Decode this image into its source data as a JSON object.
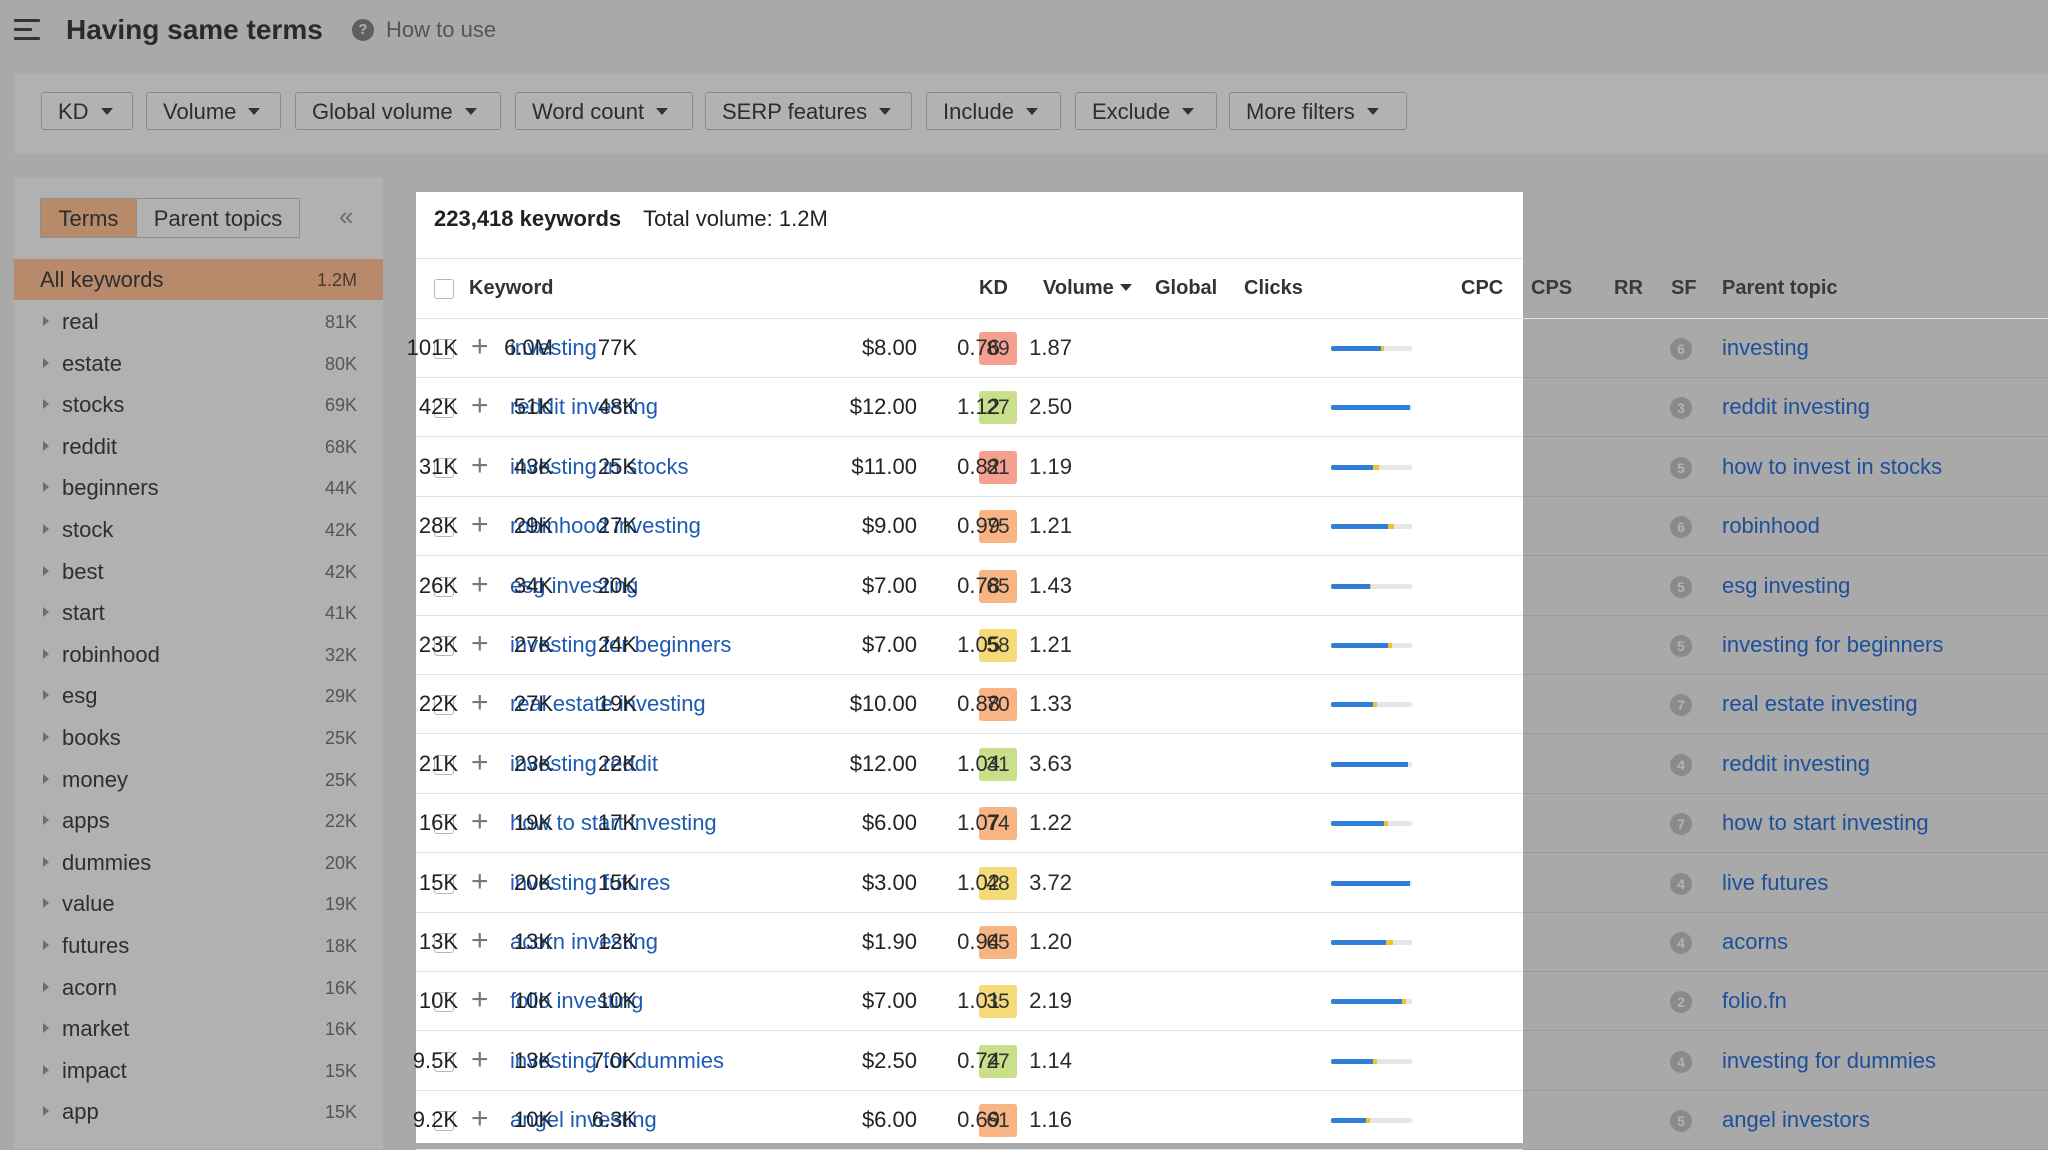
{
  "header": {
    "title": "Having same terms",
    "help_text": "How to use"
  },
  "filters": [
    "KD",
    "Volume",
    "Global volume",
    "Word count",
    "SERP features",
    "Include",
    "Exclude",
    "More filters"
  ],
  "sidebar": {
    "tabs": [
      "Terms",
      "Parent topics"
    ],
    "all_keywords": {
      "label": "All keywords",
      "count": "1.2M"
    },
    "items": [
      {
        "label": "real",
        "count": "81K"
      },
      {
        "label": "estate",
        "count": "80K"
      },
      {
        "label": "stocks",
        "count": "69K"
      },
      {
        "label": "reddit",
        "count": "68K"
      },
      {
        "label": "beginners",
        "count": "44K"
      },
      {
        "label": "stock",
        "count": "42K"
      },
      {
        "label": "best",
        "count": "42K"
      },
      {
        "label": "start",
        "count": "41K"
      },
      {
        "label": "robinhood",
        "count": "32K"
      },
      {
        "label": "esg",
        "count": "29K"
      },
      {
        "label": "books",
        "count": "25K"
      },
      {
        "label": "money",
        "count": "25K"
      },
      {
        "label": "apps",
        "count": "22K"
      },
      {
        "label": "dummies",
        "count": "20K"
      },
      {
        "label": "value",
        "count": "19K"
      },
      {
        "label": "futures",
        "count": "18K"
      },
      {
        "label": "acorn",
        "count": "16K"
      },
      {
        "label": "market",
        "count": "16K"
      },
      {
        "label": "impact",
        "count": "15K"
      },
      {
        "label": "app",
        "count": "15K"
      }
    ]
  },
  "summary": {
    "keywords": "223,418 keywords",
    "total_volume": "Total volume: 1.2M"
  },
  "columns": {
    "keyword": "Keyword",
    "kd": "KD",
    "volume": "Volume",
    "global": "Global",
    "clicks": "Clicks",
    "cpc": "CPC",
    "cps": "CPS",
    "rr": "RR",
    "sf": "SF",
    "parent_topic": "Parent topic"
  },
  "colors": {
    "kd_red": "#f5a08f",
    "kd_orange": "#f8b483",
    "kd_yellow": "#f5da78",
    "kd_lightgreen": "#c9df8a",
    "link": "#1d5ab2",
    "bar_blue": "#2f7ed8",
    "bar_yellow": "#f2c12e"
  },
  "rows": [
    {
      "keyword": "investing",
      "kd": "89",
      "kd_color": "#f5a08f",
      "volume": "101K",
      "global": "6.0M",
      "clicks": "77K",
      "organic_share": 0.62,
      "paid_share": 0.03,
      "cpc": "$8.00",
      "cps": "0.76",
      "rr": "1.87",
      "sf": "6",
      "parent_topic": "investing"
    },
    {
      "keyword": "reddit investing",
      "kd": "27",
      "kd_color": "#c9df8a",
      "volume": "42K",
      "global": "51K",
      "clicks": "48K",
      "organic_share": 0.97,
      "paid_share": 0.0,
      "cpc": "$12.00",
      "cps": "1.12",
      "rr": "2.50",
      "sf": "3",
      "parent_topic": "reddit investing"
    },
    {
      "keyword": "investing in stocks",
      "kd": "81",
      "kd_color": "#f5a08f",
      "volume": "31K",
      "global": "43K",
      "clicks": "25K",
      "organic_share": 0.52,
      "paid_share": 0.07,
      "cpc": "$11.00",
      "cps": "0.82",
      "rr": "1.19",
      "sf": "5",
      "parent_topic": "how to invest in stocks"
    },
    {
      "keyword": "robinhood investing",
      "kd": "75",
      "kd_color": "#f8b483",
      "volume": "28K",
      "global": "29K",
      "clicks": "27K",
      "organic_share": 0.7,
      "paid_share": 0.08,
      "cpc": "$9.00",
      "cps": "0.99",
      "rr": "1.21",
      "sf": "6",
      "parent_topic": "robinhood"
    },
    {
      "keyword": "esg investing",
      "kd": "65",
      "kd_color": "#f8b483",
      "volume": "26K",
      "global": "34K",
      "clicks": "20K",
      "organic_share": 0.48,
      "paid_share": 0.02,
      "cpc": "$7.00",
      "cps": "0.78",
      "rr": "1.43",
      "sf": "5",
      "parent_topic": "esg investing"
    },
    {
      "keyword": "investing for beginners",
      "kd": "58",
      "kd_color": "#f5da78",
      "volume": "23K",
      "global": "27K",
      "clicks": "24K",
      "organic_share": 0.7,
      "paid_share": 0.05,
      "cpc": "$7.00",
      "cps": "1.05",
      "rr": "1.21",
      "sf": "5",
      "parent_topic": "investing for beginners"
    },
    {
      "keyword": "real estate investing",
      "kd": "70",
      "kd_color": "#f8b483",
      "volume": "22K",
      "global": "27K",
      "clicks": "19K",
      "organic_share": 0.52,
      "paid_share": 0.05,
      "cpc": "$10.00",
      "cps": "0.88",
      "rr": "1.33",
      "sf": "7",
      "parent_topic": "real estate investing"
    },
    {
      "keyword": "investing reddit",
      "kd": "31",
      "kd_color": "#c9df8a",
      "volume": "21K",
      "global": "23K",
      "clicks": "22K",
      "organic_share": 0.95,
      "paid_share": 0.0,
      "cpc": "$12.00",
      "cps": "1.04",
      "rr": "3.63",
      "sf": "4",
      "parent_topic": "reddit investing"
    },
    {
      "keyword": "how to start investing",
      "kd": "74",
      "kd_color": "#f8b483",
      "volume": "16K",
      "global": "19K",
      "clicks": "17K",
      "organic_share": 0.66,
      "paid_share": 0.04,
      "cpc": "$6.00",
      "cps": "1.07",
      "rr": "1.22",
      "sf": "7",
      "parent_topic": "how to start investing"
    },
    {
      "keyword": "investing futures",
      "kd": "48",
      "kd_color": "#f5da78",
      "volume": "15K",
      "global": "20K",
      "clicks": "15K",
      "organic_share": 0.97,
      "paid_share": 0.0,
      "cpc": "$3.00",
      "cps": "1.02",
      "rr": "3.72",
      "sf": "4",
      "parent_topic": "live futures"
    },
    {
      "keyword": "acorn investing",
      "kd": "65",
      "kd_color": "#f8b483",
      "volume": "13K",
      "global": "13K",
      "clicks": "12K",
      "organic_share": 0.68,
      "paid_share": 0.08,
      "cpc": "$1.90",
      "cps": "0.94",
      "rr": "1.20",
      "sf": "4",
      "parent_topic": "acorns"
    },
    {
      "keyword": "folio investing",
      "kd": "35",
      "kd_color": "#f5da78",
      "volume": "10K",
      "global": "10K",
      "clicks": "10K",
      "organic_share": 0.88,
      "paid_share": 0.05,
      "cpc": "$7.00",
      "cps": "1.01",
      "rr": "2.19",
      "sf": "2",
      "parent_topic": "folio.fn"
    },
    {
      "keyword": "investing for dummies",
      "kd": "27",
      "kd_color": "#c9df8a",
      "volume": "9.5K",
      "global": "13K",
      "clicks": "7.0K",
      "organic_share": 0.52,
      "paid_share": 0.05,
      "cpc": "$2.50",
      "cps": "0.74",
      "rr": "1.14",
      "sf": "4",
      "parent_topic": "investing for dummies"
    },
    {
      "keyword": "angel investing",
      "kd": "61",
      "kd_color": "#f8b483",
      "volume": "9.2K",
      "global": "10K",
      "clicks": "6.3K",
      "organic_share": 0.43,
      "paid_share": 0.05,
      "cpc": "$6.00",
      "cps": "0.69",
      "rr": "1.16",
      "sf": "5",
      "parent_topic": "angel investors"
    }
  ]
}
